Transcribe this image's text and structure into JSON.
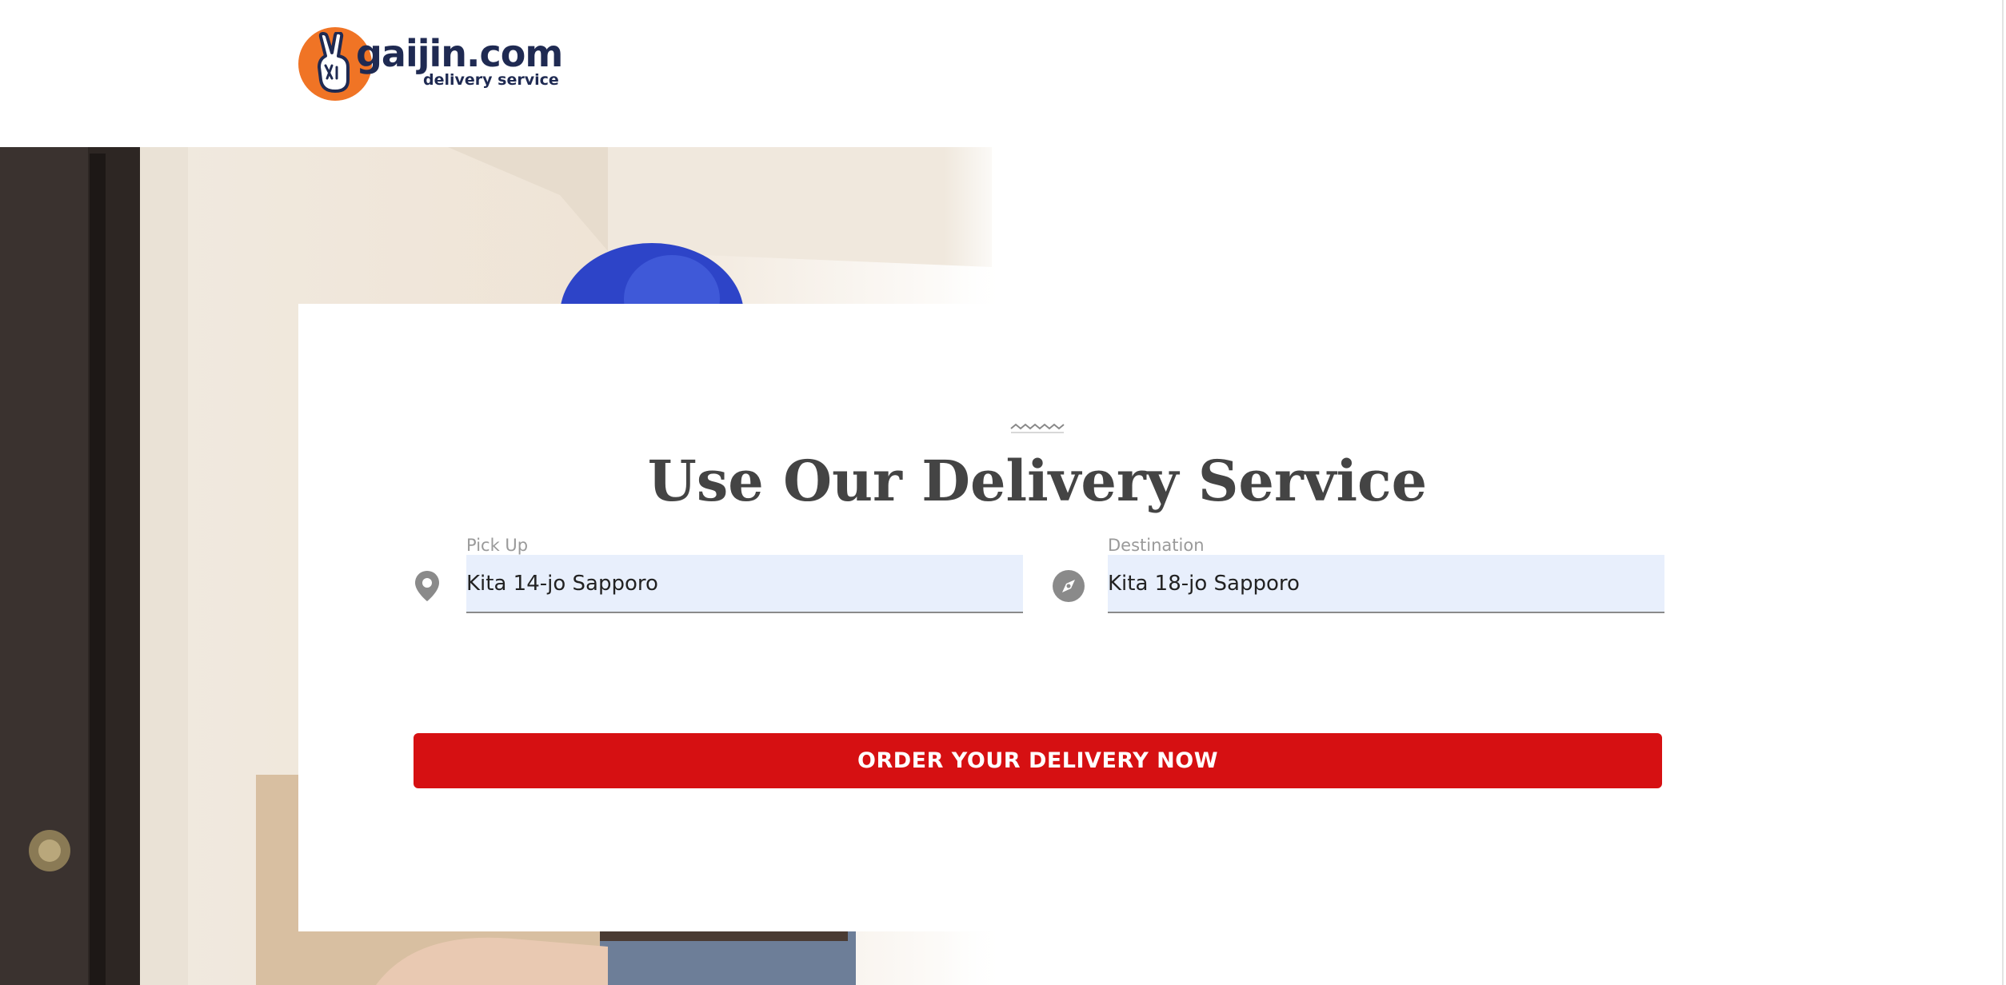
{
  "header": {
    "logo": {
      "wordmark": "gaijin.com",
      "tagline": "delivery service",
      "colors": {
        "circle": "#f07425",
        "text": "#1f2a52"
      }
    }
  },
  "hero_image": {
    "icon": "delivery-person-photo"
  },
  "card": {
    "title": "Use Our Delivery Service",
    "pickup": {
      "label": "Pick Up",
      "value": "Kita 14-jo Sapporo",
      "icon": "map-pin-icon"
    },
    "destination": {
      "label": "Destination",
      "value": "Kita 18-jo Sapporo",
      "icon": "compass-icon"
    },
    "order_button": {
      "label": "ORDER YOUR DELIVERY NOW",
      "color": "#d61012"
    }
  }
}
